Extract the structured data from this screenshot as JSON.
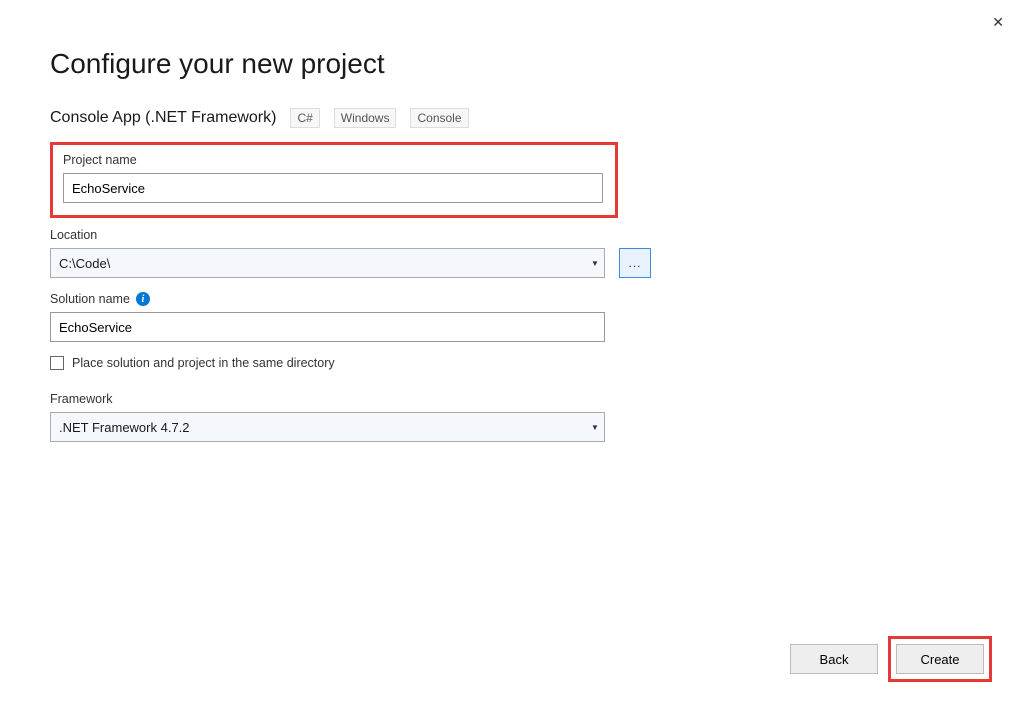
{
  "close_label": "✕",
  "title": "Configure your new project",
  "project_type": "Console App (.NET Framework)",
  "tags": [
    "C#",
    "Windows",
    "Console"
  ],
  "project_name": {
    "label": "Project name",
    "value": "EchoService"
  },
  "location": {
    "label": "Location",
    "value": "C:\\Code\\",
    "browse_label": "..."
  },
  "solution_name": {
    "label": "Solution name",
    "value": "EchoService"
  },
  "checkbox": {
    "label": "Place solution and project in the same directory",
    "checked": false
  },
  "framework": {
    "label": "Framework",
    "value": ".NET Framework 4.7.2"
  },
  "buttons": {
    "back": "Back",
    "create": "Create"
  }
}
